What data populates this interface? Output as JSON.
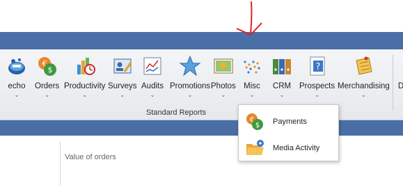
{
  "ribbon": {
    "buttons": [
      {
        "label": "echo",
        "icon": "echo-icon"
      },
      {
        "label": "Orders",
        "icon": "orders-currency-icon"
      },
      {
        "label": "Productivity",
        "icon": "productivity-chart-icon"
      },
      {
        "label": "Surveys",
        "icon": "surveys-icon"
      },
      {
        "label": "Audits",
        "icon": "audits-icon"
      },
      {
        "label": "Promotions",
        "icon": "star-icon"
      },
      {
        "label": "Photos",
        "icon": "photos-icon"
      },
      {
        "label": "Misc",
        "icon": "misc-dots-icon"
      },
      {
        "label": "CRM",
        "icon": "crm-binders-icon"
      },
      {
        "label": "Prospects",
        "icon": "prospects-icon"
      },
      {
        "label": "Merchandising",
        "icon": "merchandising-icon"
      },
      {
        "label": "D",
        "icon": ""
      }
    ],
    "group_label": "Standard Reports"
  },
  "misc_menu": {
    "items": [
      {
        "label": "Payments",
        "icon": "payments-icon"
      },
      {
        "label": "Media Activity",
        "icon": "media-folder-icon"
      }
    ]
  },
  "content": {
    "chart_title": "Value of orders"
  },
  "colors": {
    "titlebar": "#4a6ea6",
    "annotation_arrow": "#e02020"
  }
}
